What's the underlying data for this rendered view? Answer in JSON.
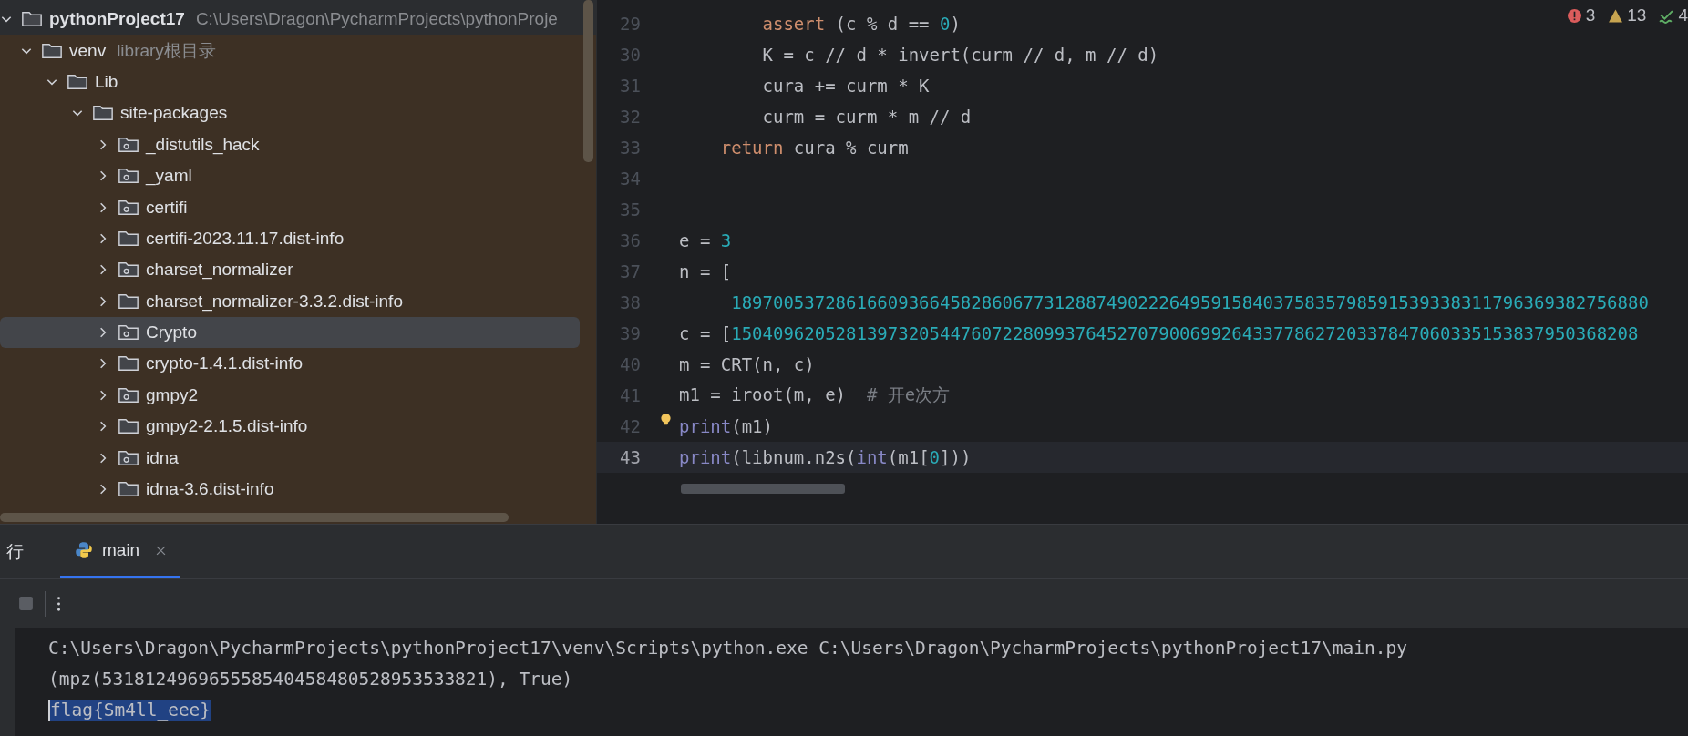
{
  "project_tree": {
    "root": {
      "name": "pythonProject17",
      "path": "C:\\Users\\Dragon\\PycharmProjects\\pythonProje",
      "kind": "folder",
      "expanded": true,
      "selected": false,
      "children": [
        {
          "name": "venv",
          "hint": "library根目录",
          "kind": "folder",
          "expanded": true,
          "selected": false,
          "children": [
            {
              "name": "Lib",
              "kind": "folder",
              "expanded": true,
              "selected": false,
              "children": [
                {
                  "name": "site-packages",
                  "kind": "folder",
                  "expanded": true,
                  "selected": false,
                  "children": [
                    {
                      "name": "_distutils_hack",
                      "kind": "package",
                      "expanded": false,
                      "selected": false
                    },
                    {
                      "name": "_yaml",
                      "kind": "package",
                      "expanded": false,
                      "selected": false
                    },
                    {
                      "name": "certifi",
                      "kind": "package",
                      "expanded": false,
                      "selected": false
                    },
                    {
                      "name": "certifi-2023.11.17.dist-info",
                      "kind": "folder",
                      "expanded": false,
                      "selected": false
                    },
                    {
                      "name": "charset_normalizer",
                      "kind": "package",
                      "expanded": false,
                      "selected": false
                    },
                    {
                      "name": "charset_normalizer-3.3.2.dist-info",
                      "kind": "folder",
                      "expanded": false,
                      "selected": false
                    },
                    {
                      "name": "Crypto",
                      "kind": "package",
                      "expanded": false,
                      "selected": true
                    },
                    {
                      "name": "crypto-1.4.1.dist-info",
                      "kind": "folder",
                      "expanded": false,
                      "selected": false
                    },
                    {
                      "name": "gmpy2",
                      "kind": "package",
                      "expanded": false,
                      "selected": false
                    },
                    {
                      "name": "gmpy2-2.1.5.dist-info",
                      "kind": "folder",
                      "expanded": false,
                      "selected": false
                    },
                    {
                      "name": "idna",
                      "kind": "package",
                      "expanded": false,
                      "selected": false
                    },
                    {
                      "name": "idna-3.6.dist-info",
                      "kind": "folder",
                      "expanded": false,
                      "selected": false
                    }
                  ]
                }
              ]
            }
          ]
        }
      ]
    }
  },
  "editor": {
    "inspections": [
      {
        "kind": "error",
        "count": "3"
      },
      {
        "kind": "warning",
        "count": "13"
      },
      {
        "kind": "typo",
        "count": "4"
      }
    ],
    "lines": [
      {
        "number": "29",
        "current": false,
        "tokens": [
          {
            "text": "        assert",
            "kind": "keyword"
          },
          {
            "text": " (c % d == ",
            "kind": "plain"
          },
          {
            "text": "0",
            "kind": "number"
          },
          {
            "text": ")",
            "kind": "plain"
          }
        ]
      },
      {
        "number": "30",
        "current": false,
        "tokens": [
          {
            "text": "        К = c // d * invert(curm // d, m // d)",
            "kind": "plain"
          }
        ]
      },
      {
        "number": "31",
        "current": false,
        "tokens": [
          {
            "text": "        cura += curm * К",
            "kind": "plain"
          }
        ]
      },
      {
        "number": "32",
        "current": false,
        "tokens": [
          {
            "text": "        curm = curm * m // d",
            "kind": "plain"
          }
        ]
      },
      {
        "number": "33",
        "current": false,
        "tokens": [
          {
            "text": "    return",
            "kind": "keyword"
          },
          {
            "text": " cura % curm",
            "kind": "plain"
          }
        ]
      },
      {
        "number": "34",
        "current": false
      },
      {
        "number": "35",
        "current": false
      },
      {
        "number": "36",
        "current": false,
        "tokens": [
          {
            "text": "e = ",
            "kind": "plain"
          },
          {
            "text": "3",
            "kind": "number"
          }
        ]
      },
      {
        "number": "37",
        "current": false,
        "tokens": [
          {
            "text": "n = [",
            "kind": "plain"
          }
        ]
      },
      {
        "number": "38",
        "current": false,
        "tokens": [
          {
            "text": "     1897005372861660936645828606773128874902226495915840375835798591539338311796369382756880",
            "kind": "number"
          }
        ]
      },
      {
        "number": "39",
        "current": false,
        "tokens": [
          {
            "text": "c = [",
            "kind": "plain"
          },
          {
            "text": "150409620528139732054476072280993764527079006992643377862720337847060335153837950368208",
            "kind": "number"
          }
        ]
      },
      {
        "number": "40",
        "current": false,
        "tokens": [
          {
            "text": "m = CRT(n, c)",
            "kind": "plain"
          }
        ]
      },
      {
        "number": "41",
        "current": false,
        "tokens": [
          {
            "text": "m1 = iroot(m, e)  ",
            "kind": "plain"
          },
          {
            "text": "# 开e次方",
            "kind": "comment"
          }
        ]
      },
      {
        "number": "42",
        "current": false,
        "bulb": true,
        "tokens": [
          {
            "text": "print",
            "kind": "builtin"
          },
          {
            "text": "(m1)",
            "kind": "plain"
          }
        ]
      },
      {
        "number": "43",
        "current": true,
        "tokens": [
          {
            "text": "print",
            "kind": "builtin"
          },
          {
            "text": "(libnum.n2s(",
            "kind": "plain"
          },
          {
            "text": "int",
            "kind": "builtin"
          },
          {
            "text": "(m1[",
            "kind": "plain"
          },
          {
            "text": "0",
            "kind": "number"
          },
          {
            "text": "]))",
            "kind": "plain"
          }
        ]
      }
    ]
  },
  "run_panel": {
    "title": "行",
    "tabs": [
      {
        "label": "main",
        "selected": true
      }
    ],
    "console": [
      {
        "text": "C:\\Users\\Dragon\\PycharmProjects\\pythonProject17\\venv\\Scripts\\python.exe C:\\Users\\Dragon\\PycharmProjects\\pythonProject17\\main.py",
        "selected": false
      },
      {
        "text": "(mpz(531812496965558540458480528953533821), True)",
        "selected": false
      },
      {
        "text": "flag{Sm4ll_eee}",
        "selected": true
      }
    ]
  }
}
